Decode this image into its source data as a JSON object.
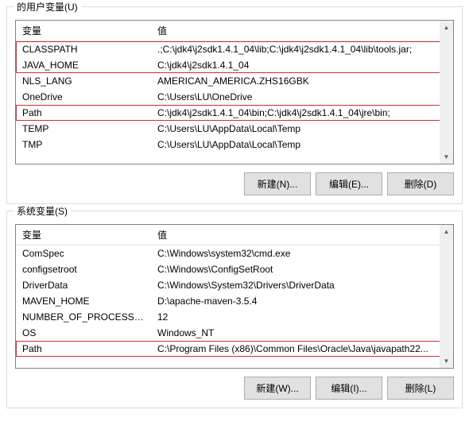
{
  "userVars": {
    "title": "的用户变量(U)",
    "col1": "变量",
    "col2": "值",
    "rows": [
      {
        "name": "CLASSPATH",
        "value": ".;C:\\jdk4\\j2sdk1.4.1_04\\lib;C:\\jdk4\\j2sdk1.4.1_04\\lib\\tools.jar;",
        "hl": "group-top"
      },
      {
        "name": "JAVA_HOME",
        "value": "C:\\jdk4\\j2sdk1.4.1_04",
        "hl": "group-bottom"
      },
      {
        "name": "NLS_LANG",
        "value": "AMERICAN_AMERICA.ZHS16GBK",
        "hl": ""
      },
      {
        "name": "OneDrive",
        "value": "C:\\Users\\LU\\OneDrive",
        "hl": ""
      },
      {
        "name": "Path",
        "value": "C:\\jdk4\\j2sdk1.4.1_04\\bin;C:\\jdk4\\j2sdk1.4.1_04\\jre\\bin;",
        "hl": "row"
      },
      {
        "name": "TEMP",
        "value": "C:\\Users\\LU\\AppData\\Local\\Temp",
        "hl": ""
      },
      {
        "name": "TMP",
        "value": "C:\\Users\\LU\\AppData\\Local\\Temp",
        "hl": ""
      }
    ],
    "btnNew": "新建(N)...",
    "btnEdit": "编辑(E)...",
    "btnDelete": "删除(D)"
  },
  "sysVars": {
    "title": "系统变量(S)",
    "col1": "变量",
    "col2": "值",
    "rows": [
      {
        "name": "ComSpec",
        "value": "C:\\Windows\\system32\\cmd.exe",
        "hl": ""
      },
      {
        "name": "configsetroot",
        "value": "C:\\Windows\\ConfigSetRoot",
        "hl": ""
      },
      {
        "name": "DriverData",
        "value": "C:\\Windows\\System32\\Drivers\\DriverData",
        "hl": ""
      },
      {
        "name": "MAVEN_HOME",
        "value": "D:\\apache-maven-3.5.4",
        "hl": ""
      },
      {
        "name": "NUMBER_OF_PROCESSORS",
        "value": "12",
        "hl": ""
      },
      {
        "name": "OS",
        "value": "Windows_NT",
        "hl": ""
      },
      {
        "name": "Path",
        "value": "C:\\Program Files (x86)\\Common Files\\Oracle\\Java\\javapath22...",
        "hl": "row"
      }
    ],
    "btnNew": "新建(W)...",
    "btnEdit": "编辑(I)...",
    "btnDelete": "删除(L)"
  }
}
